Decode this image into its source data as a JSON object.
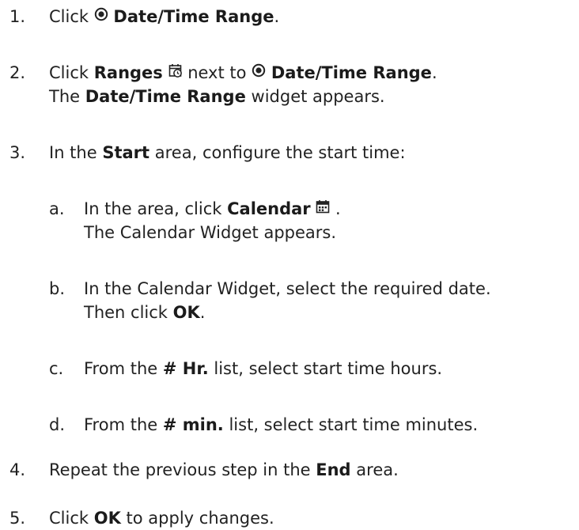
{
  "steps": [
    {
      "num": "1.",
      "parts": {
        "a": "Click",
        "b": "Date/Time Range",
        "c": "."
      }
    },
    {
      "num": "2.",
      "parts": {
        "a": "Click",
        "b": "Ranges",
        "c": "next to",
        "d": "Date/Time Range",
        "e": "."
      },
      "result": {
        "a": "The",
        "b": "Date/Time Range",
        "c": "widget appears."
      }
    },
    {
      "num": "3.",
      "parts": {
        "a": "In the",
        "b": "Start",
        "c": "area, configure the start time:"
      },
      "substeps": [
        {
          "letter": "a.",
          "parts": {
            "a": "In the area, click",
            "b": "Calendar",
            "c": "."
          },
          "result": "The Calendar Widget appears."
        },
        {
          "letter": "b.",
          "text": "In the Calendar Widget, select the required date.",
          "then": {
            "a": "Then click",
            "b": "OK",
            "c": "."
          }
        },
        {
          "letter": "c.",
          "parts": {
            "a": "From the",
            "b": "# Hr.",
            "c": "list, select start time hours."
          }
        },
        {
          "letter": "d.",
          "parts": {
            "a": "From the",
            "b": "# min.",
            "c": "list, select start time minutes."
          }
        }
      ]
    },
    {
      "num": "4.",
      "parts": {
        "a": "Repeat the previous step in the",
        "b": "End",
        "c": "area."
      }
    },
    {
      "num": "5.",
      "parts": {
        "a": "Click",
        "b": "OK",
        "c": "to apply changes."
      }
    }
  ],
  "icons": {
    "radio": "radio-selected-icon",
    "ranges": "ranges-clock-icon",
    "calendar": "calendar-icon"
  }
}
